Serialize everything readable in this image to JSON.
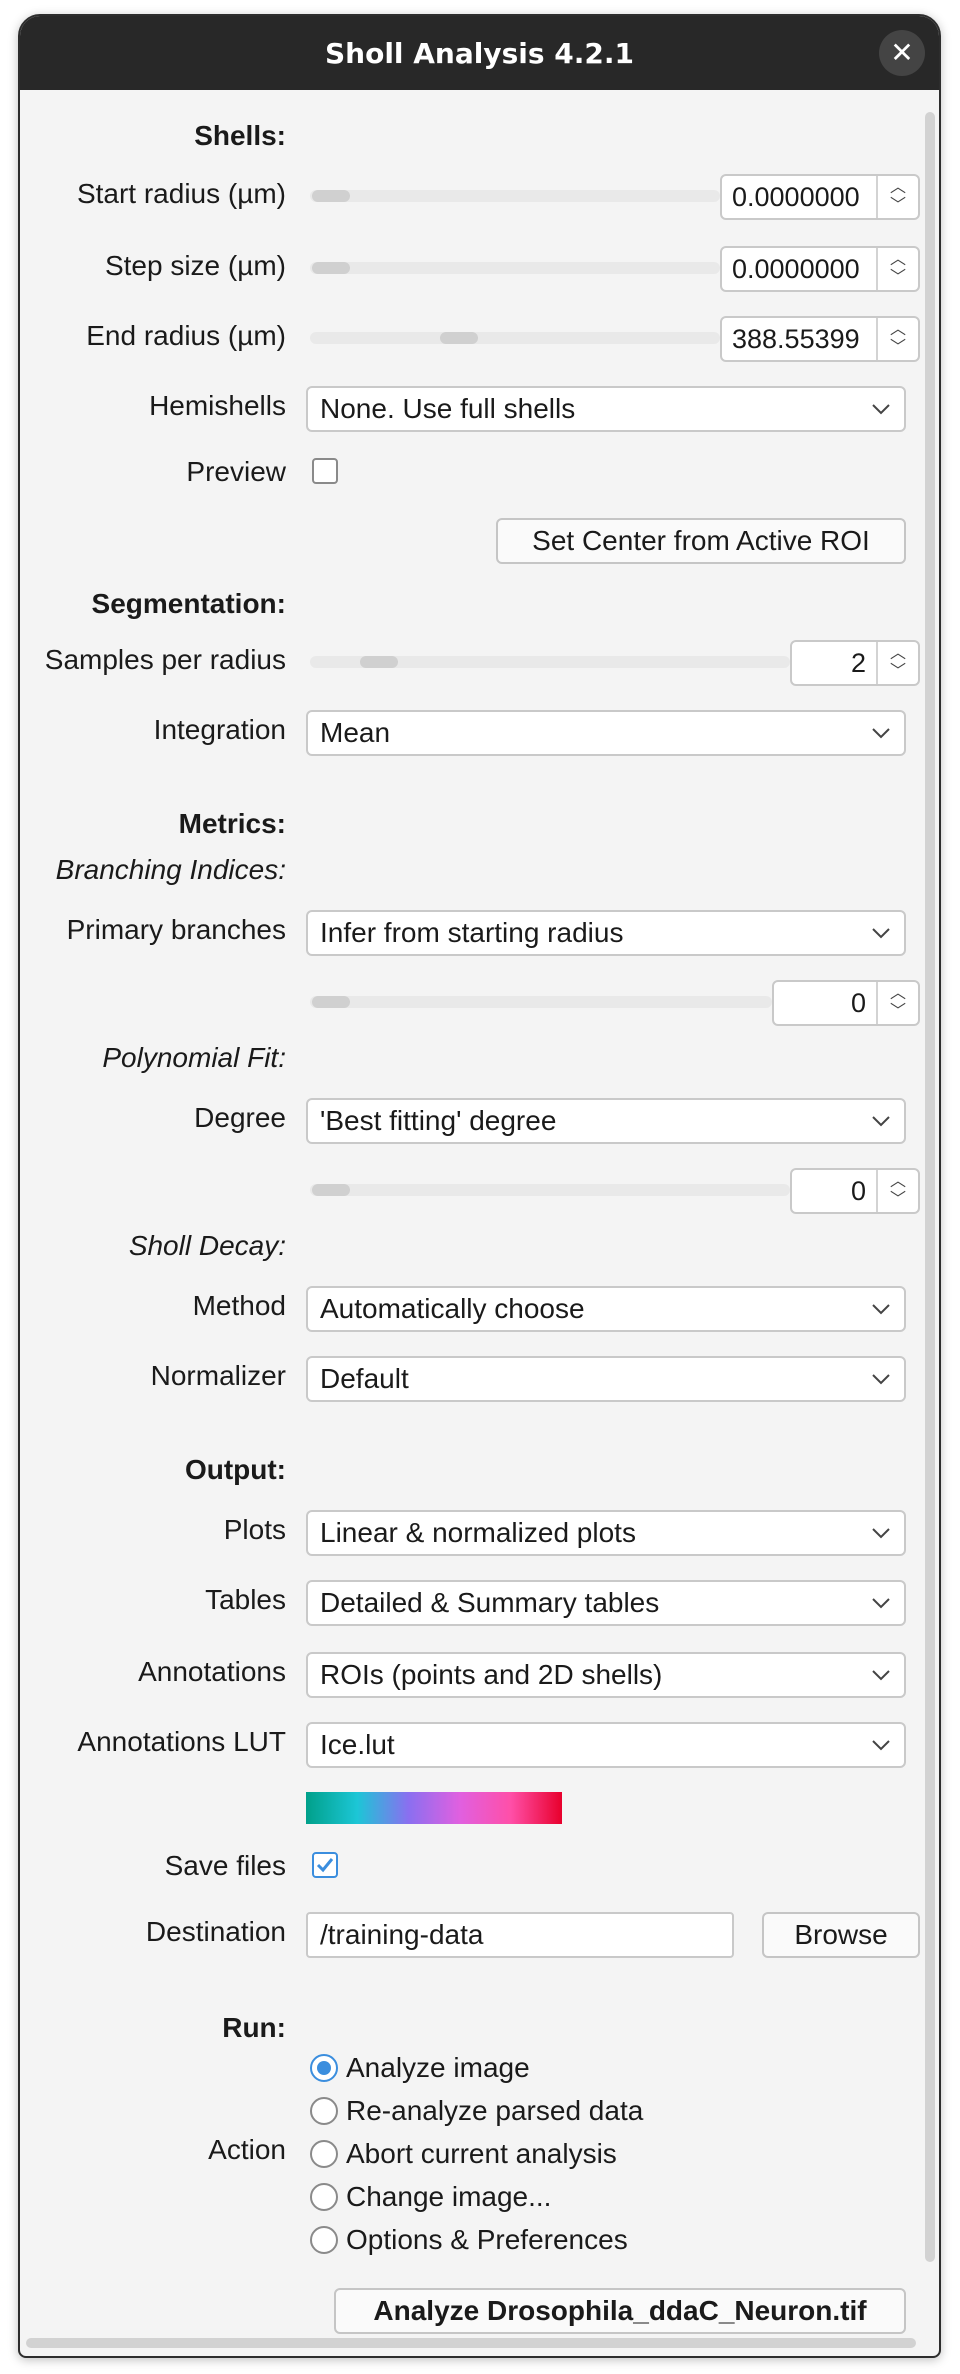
{
  "window": {
    "title": "Sholl Analysis 4.2.1",
    "close_glyph": "✕"
  },
  "shells": {
    "heading": "Shells:",
    "start_radius": {
      "label": "Start radius (µm)",
      "value": "0.0000000",
      "slider_fraction": 0.0
    },
    "step_size": {
      "label": "Step size (µm)",
      "value": "0.0000000",
      "slider_fraction": 0.0
    },
    "end_radius": {
      "label": "End radius (µm)",
      "value": "388.55399",
      "slider_fraction": 0.32
    },
    "hemishells": {
      "label": "Hemishells",
      "value": "None. Use full shells"
    },
    "preview": {
      "label": "Preview",
      "checked": false
    },
    "set_center_button": "Set Center from Active ROI"
  },
  "segmentation": {
    "heading": "Segmentation:",
    "samples_per_radius": {
      "label": "Samples per radius",
      "value": "2",
      "slider_fraction": 0.1
    },
    "integration": {
      "label": "Integration",
      "value": "Mean"
    }
  },
  "metrics": {
    "heading": "Metrics:",
    "branching_heading": "Branching Indices:",
    "primary_branches": {
      "label": "Primary branches",
      "value": "Infer from starting radius",
      "spin_value": "0"
    },
    "polynomial_heading": "Polynomial Fit:",
    "degree": {
      "label": "Degree",
      "value": "'Best fitting' degree",
      "spin_value": "0"
    },
    "decay_heading": "Sholl Decay:",
    "method": {
      "label": "Method",
      "value": "Automatically choose"
    },
    "normalizer": {
      "label": "Normalizer",
      "value": "Default"
    }
  },
  "output": {
    "heading": "Output:",
    "plots": {
      "label": "Plots",
      "value": "Linear & normalized plots"
    },
    "tables": {
      "label": "Tables",
      "value": "Detailed & Summary tables"
    },
    "annotations": {
      "label": "Annotations",
      "value": "ROIs (points and 2D shells)"
    },
    "annotations_lut": {
      "label": "Annotations LUT",
      "value": "Ice.lut",
      "lut_colors": [
        "#00a08a",
        "#1cc6d6",
        "#8a6ff0",
        "#e060e0",
        "#ff4fa8",
        "#e8002c"
      ]
    },
    "save_files": {
      "label": "Save files",
      "checked": true
    },
    "destination": {
      "label": "Destination",
      "value": "/training-data"
    },
    "browse_button": "Browse"
  },
  "run": {
    "heading": "Run:",
    "action_label": "Action",
    "options": [
      {
        "label": "Analyze image",
        "selected": true
      },
      {
        "label": "Re-analyze parsed data",
        "selected": false
      },
      {
        "label": "Abort current analysis",
        "selected": false
      },
      {
        "label": "Change image...",
        "selected": false
      },
      {
        "label": "Options & Preferences",
        "selected": false
      }
    ],
    "analyze_button": "Analyze Drosophila_ddaC_Neuron.tif"
  },
  "colors": {
    "accent": "#3b8ede",
    "titlebar": "#282828"
  }
}
